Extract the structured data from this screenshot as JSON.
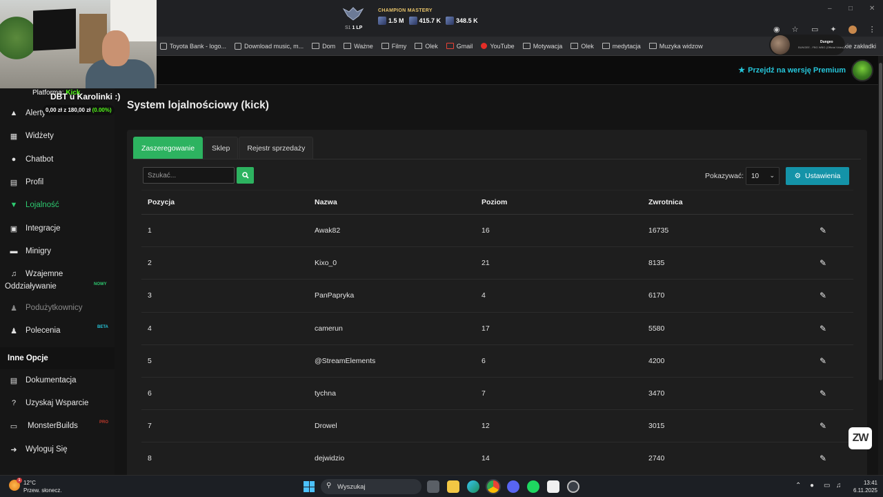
{
  "browser": {
    "mastery": {
      "title": "CHAMPION MASTERY",
      "rank": "S1",
      "lp": "1 LP",
      "stats": [
        "1.5 M",
        "415.7 K",
        "348.5 K"
      ]
    },
    "bookmarks": [
      {
        "label": "Toyota Bank - logo...",
        "icon": "file-icon"
      },
      {
        "label": "Download music, m...",
        "icon": "file-icon"
      },
      {
        "label": "Dom",
        "icon": "folder-icon"
      },
      {
        "label": "Ważne",
        "icon": "folder-icon"
      },
      {
        "label": "Filmy",
        "icon": "folder-icon"
      },
      {
        "label": "Olek",
        "icon": "folder-icon"
      },
      {
        "label": "Gmail",
        "icon": "gmail-icon"
      },
      {
        "label": "YouTube",
        "icon": "youtube-icon"
      },
      {
        "label": "Motywacja",
        "icon": "folder-icon"
      },
      {
        "label": "Olek",
        "icon": "folder-icon"
      },
      {
        "label": "medytacja",
        "icon": "folder-icon"
      },
      {
        "label": "Muzyka widzow",
        "icon": "folder-icon"
      }
    ],
    "bookmarks_right": "kie zakładki",
    "profile_chip": {
      "name": "Dungeo",
      "subtitle": "BUNGEE - FBG WBG (Official Video)"
    }
  },
  "overlay": {
    "platform_label": "Platforma:",
    "platform_value": "Kick",
    "goal_title": "DBT u Karolinki :)",
    "money_current": "0,00 zł",
    "money_sep": "z",
    "money_goal": "180,00 zł",
    "money_pct": "(0.00%)"
  },
  "header": {
    "premium_label": "Przejdź na wersję Premium"
  },
  "sidebar": {
    "items": [
      {
        "label": "Alerty",
        "icon": "warning-icon"
      },
      {
        "label": "Widżety",
        "icon": "widgets-icon"
      },
      {
        "label": "Chatbot",
        "icon": "robot-icon"
      },
      {
        "label": "Profil",
        "icon": "id-card-icon"
      },
      {
        "label": "Lojalność",
        "icon": "trophy-icon"
      },
      {
        "label": "Integracje",
        "icon": "integrations-icon"
      },
      {
        "label": "Minigry",
        "icon": "gamepad-icon"
      },
      {
        "label": "Wzajemne",
        "label2": "Oddziaływanie",
        "icon": "music-icon",
        "badge": "NOWY"
      },
      {
        "label": "Podużytkownicy",
        "icon": "users-icon"
      },
      {
        "label": "Polecenia",
        "icon": "users-icon",
        "badge": "BETA"
      }
    ],
    "section_title": "Inne Opcje",
    "other_items": [
      {
        "label": "Dokumentacja",
        "icon": "docs-icon"
      },
      {
        "label": "Uzyskaj Wsparcie",
        "icon": "question-icon"
      },
      {
        "label": "MonsterBuilds",
        "icon": "laptop-icon",
        "badge": "PRO"
      },
      {
        "label": "Wyloguj Się",
        "icon": "logout-icon"
      }
    ]
  },
  "main": {
    "title": "System lojalnościowy (kick)",
    "tabs": [
      "Zaszeregowanie",
      "Sklep",
      "Rejestr sprzedaży"
    ],
    "search_placeholder": "Szukać...",
    "show_label": "Pokazywać:",
    "show_value": "10",
    "settings_label": "Ustawienia",
    "table": {
      "headers": [
        "Pozycja",
        "Nazwa",
        "Poziom",
        "Zwrotnica"
      ],
      "rows": [
        [
          "1",
          "Awak82",
          "16",
          "16735"
        ],
        [
          "2",
          "Kixo_0",
          "21",
          "8135"
        ],
        [
          "3",
          "PanPapryka",
          "4",
          "6170"
        ],
        [
          "4",
          "camerun",
          "17",
          "5580"
        ],
        [
          "5",
          "@StreamElements",
          "6",
          "4200"
        ],
        [
          "6",
          "tychna",
          "7",
          "3470"
        ],
        [
          "7",
          "Drowel",
          "12",
          "3015"
        ],
        [
          "8",
          "dejwidzio",
          "14",
          "2740"
        ]
      ]
    }
  },
  "widget": {
    "label": "ZW"
  },
  "taskbar": {
    "weather_temp": "12°C",
    "weather_desc": "Przew. słonecz.",
    "weather_badge": "1",
    "search_label": "Wyszukaj",
    "time": "13:41",
    "date": "6.11.2025"
  },
  "colors": {
    "accent_green": "#2db360",
    "accent_teal": "#1493a8",
    "premium": "#26c6da",
    "kick_green": "#53fc18"
  }
}
